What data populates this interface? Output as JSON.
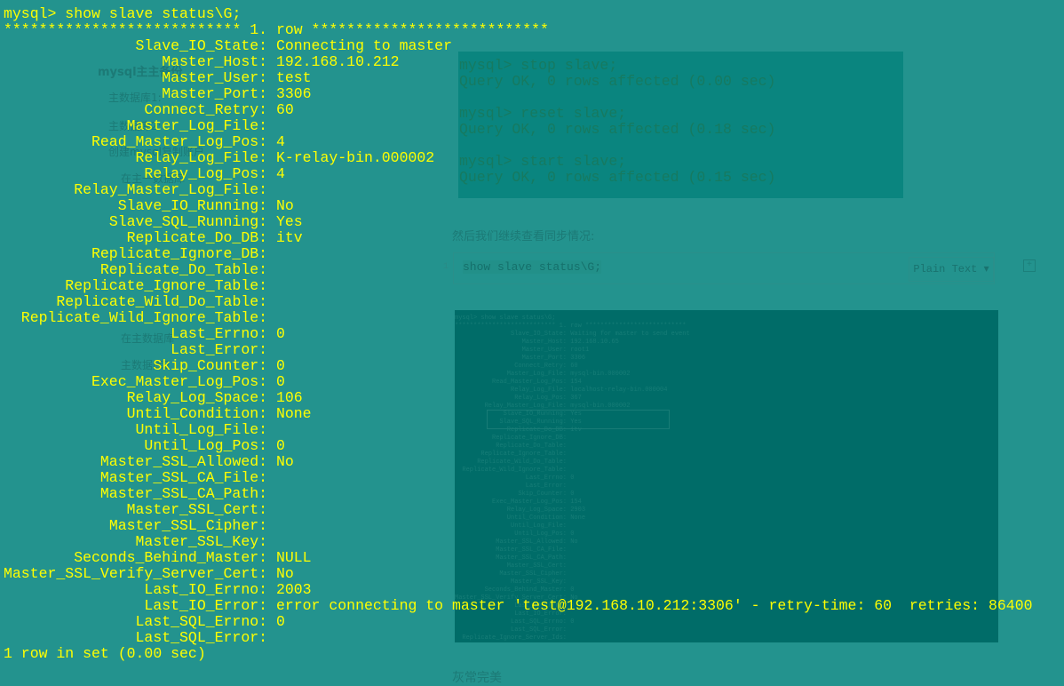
{
  "background_page": {
    "headings": [
      "mysql主主备份",
      "主数据库1:",
      "主数据库2:",
      "创建mysql复制账户",
      "在主一数据库",
      "在主数据库",
      "主数据库2"
    ],
    "paragraph": "然后我们继续查看同步情况:",
    "footer_text": "灰常完美",
    "top_output": [
      "mysql> stop slave;",
      "Query OK, 0 rows affected (0.00 sec)",
      "",
      "mysql> reset slave;",
      "Query OK, 0 rows affected (0.18 sec)",
      "",
      "mysql> start slave;",
      "Query OK, 0 rows affected (0.15 sec)"
    ],
    "code_block": {
      "line_number": "1",
      "code": "show slave status\\G;",
      "language": "Plain Text ▾",
      "comment_icon": "+"
    },
    "embedded_image": {
      "header": [
        "mysql> show slave status\\G;",
        "*************************** 1. row ***************************"
      ],
      "rows": [
        [
          "Slave_IO_State:",
          "Waiting for master to send event"
        ],
        [
          "Master_Host:",
          "192.168.10.65"
        ],
        [
          "Master_User:",
          "root1"
        ],
        [
          "Master_Port:",
          "3306"
        ],
        [
          "Connect_Retry:",
          "60"
        ],
        [
          "Master_Log_File:",
          "mysql-bin.000002"
        ],
        [
          "Read_Master_Log_Pos:",
          "154"
        ],
        [
          "Relay_Log_File:",
          "localhost-relay-bin.000004"
        ],
        [
          "Relay_Log_Pos:",
          "367"
        ],
        [
          "Relay_Master_Log_File:",
          "mysql-bin.000002"
        ],
        [
          "Slave_IO_Running:",
          "Yes"
        ],
        [
          "Slave_SQL_Running:",
          "Yes"
        ],
        [
          "Replicate_Do_DB:",
          "itv"
        ],
        [
          "Replicate_Ignore_DB:",
          ""
        ],
        [
          "Replicate_Do_Table:",
          ""
        ],
        [
          "Replicate_Ignore_Table:",
          ""
        ],
        [
          "Replicate_Wild_Do_Table:",
          ""
        ],
        [
          "Replicate_Wild_Ignore_Table:",
          ""
        ],
        [
          "Last_Errno:",
          "0"
        ],
        [
          "Last_Error:",
          ""
        ],
        [
          "Skip_Counter:",
          "0"
        ],
        [
          "Exec_Master_Log_Pos:",
          "154"
        ],
        [
          "Relay_Log_Space:",
          "2903"
        ],
        [
          "Until_Condition:",
          "None"
        ],
        [
          "Until_Log_File:",
          ""
        ],
        [
          "Until_Log_Pos:",
          "0"
        ],
        [
          "Master_SSL_Allowed:",
          "No"
        ],
        [
          "Master_SSL_CA_File:",
          ""
        ],
        [
          "Master_SSL_CA_Path:",
          ""
        ],
        [
          "Master_SSL_Cert:",
          ""
        ],
        [
          "Master_SSL_Cipher:",
          ""
        ],
        [
          "Master_SSL_Key:",
          ""
        ],
        [
          "Seconds_Behind_Master:",
          "0"
        ],
        [
          "Master_SSL_Verify_Server_Cert:",
          "No"
        ],
        [
          "Last_IO_Errno:",
          "0"
        ],
        [
          "Last_IO_Error:",
          ""
        ],
        [
          "Last_SQL_Errno:",
          "0"
        ],
        [
          "Last_SQL_Error:",
          ""
        ],
        [
          "Replicate_Ignore_Server_Ids:",
          ""
        ]
      ]
    }
  },
  "terminal": {
    "prompt_line": "mysql> show slave status\\G;",
    "row_header": "*************************** 1. row ***************************",
    "rows": [
      [
        "Slave_IO_State:",
        "Connecting to master"
      ],
      [
        "Master_Host:",
        "192.168.10.212"
      ],
      [
        "Master_User:",
        "test"
      ],
      [
        "Master_Port:",
        "3306"
      ],
      [
        "Connect_Retry:",
        "60"
      ],
      [
        "Master_Log_File:",
        ""
      ],
      [
        "Read_Master_Log_Pos:",
        "4"
      ],
      [
        "Relay_Log_File:",
        "K-relay-bin.000002"
      ],
      [
        "Relay_Log_Pos:",
        "4"
      ],
      [
        "Relay_Master_Log_File:",
        ""
      ],
      [
        "Slave_IO_Running:",
        "No"
      ],
      [
        "Slave_SQL_Running:",
        "Yes"
      ],
      [
        "Replicate_Do_DB:",
        "itv"
      ],
      [
        "Replicate_Ignore_DB:",
        ""
      ],
      [
        "Replicate_Do_Table:",
        ""
      ],
      [
        "Replicate_Ignore_Table:",
        ""
      ],
      [
        "Replicate_Wild_Do_Table:",
        ""
      ],
      [
        "Replicate_Wild_Ignore_Table:",
        ""
      ],
      [
        "Last_Errno:",
        "0"
      ],
      [
        "Last_Error:",
        ""
      ],
      [
        "Skip_Counter:",
        "0"
      ],
      [
        "Exec_Master_Log_Pos:",
        "0"
      ],
      [
        "Relay_Log_Space:",
        "106"
      ],
      [
        "Until_Condition:",
        "None"
      ],
      [
        "Until_Log_File:",
        ""
      ],
      [
        "Until_Log_Pos:",
        "0"
      ],
      [
        "Master_SSL_Allowed:",
        "No"
      ],
      [
        "Master_SSL_CA_File:",
        ""
      ],
      [
        "Master_SSL_CA_Path:",
        ""
      ],
      [
        "Master_SSL_Cert:",
        ""
      ],
      [
        "Master_SSL_Cipher:",
        ""
      ],
      [
        "Master_SSL_Key:",
        ""
      ],
      [
        "Seconds_Behind_Master:",
        "NULL"
      ],
      [
        "Master_SSL_Verify_Server_Cert:",
        "No"
      ],
      [
        "Last_IO_Errno:",
        "2003"
      ],
      [
        "Last_IO_Error:",
        "error connecting to master 'test@192.168.10.212:3306' - retry-time: 60  retries: 86400"
      ],
      [
        "Last_SQL_Errno:",
        "0"
      ],
      [
        "Last_SQL_Error:",
        ""
      ]
    ],
    "footer": "1 row in set (0.00 sec)"
  },
  "colors": {
    "background": "#23938e",
    "terminal_text": "#ffff00",
    "embedded_image_bg": "#006c68",
    "output_box_bg": "#0a857f"
  }
}
